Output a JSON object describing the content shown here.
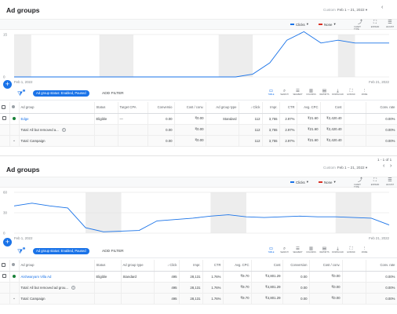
{
  "panel1": {
    "title": "Ad groups",
    "date_label": "Custom",
    "date_range": "Feb 1 – 21, 2022",
    "metric1": "Clicks",
    "metric2": "None",
    "metric1_color": "#1a73e8",
    "metric2_color": "#d93025",
    "chart_buttons": [
      "CHART TYPE",
      "EXPAND",
      "ADJUST"
    ],
    "chart_icons": [
      "trend-icon",
      "expand-icon",
      "adjust-icon"
    ],
    "chart_glyphs": [
      "⤴",
      "⛶",
      "☰"
    ],
    "chart_data": {
      "type": "line",
      "x_labels": [
        "Feb 1, 2022",
        "Feb 21, 2022"
      ],
      "y_ticks": [
        "15",
        "0"
      ],
      "ylim": [
        0,
        15
      ],
      "weekend_bands": [
        [
          0,
          1
        ],
        [
          5,
          7
        ],
        [
          12,
          14
        ],
        [
          19,
          20
        ]
      ],
      "series": [
        {
          "values": [
            0,
            0,
            0,
            0,
            0,
            0,
            0,
            0,
            0,
            0,
            0,
            0,
            0,
            0,
            1,
            5,
            13,
            16,
            12,
            13,
            12,
            12,
            12
          ]
        }
      ]
    },
    "filter_chip": "Ad group status: Enabled, Paused",
    "filter_badge": "1",
    "add_filter": "ADD FILTER",
    "tools": [
      {
        "label": "TABLE",
        "icon": "table-icon",
        "glyph": "▭",
        "active": true
      },
      {
        "label": "SEARCH",
        "icon": "search-icon",
        "glyph": "⌕",
        "active": false
      },
      {
        "label": "SEGMENT",
        "icon": "segment-icon",
        "glyph": "☰",
        "active": false
      },
      {
        "label": "COLUMNS",
        "icon": "columns-icon",
        "glyph": "▥",
        "active": false
      },
      {
        "label": "REPORTS",
        "icon": "reports-icon",
        "glyph": "▤",
        "active": false
      },
      {
        "label": "DOWNLOAD",
        "icon": "download-icon",
        "glyph": "⤓",
        "active": false
      },
      {
        "label": "EXPAND",
        "icon": "expand-icon",
        "glyph": "⛶",
        "active": false
      },
      {
        "label": "MORE",
        "icon": "more-icon",
        "glyph": "⋮",
        "active": false
      }
    ],
    "columns": [
      "Ad group",
      "Status",
      "Target CPA",
      "Conversio",
      "Cost / conv.",
      "Ad group type",
      "↓ Click",
      "Impr.",
      "CTR",
      "Avg. CPC",
      "Cost",
      "",
      "Conv. rate"
    ],
    "rows": [
      [
        "Edge",
        "Eligible",
        "—",
        "0.00",
        "₹0.00",
        "Standard",
        "112",
        "3,755",
        "2.97%",
        "₹21.60",
        "₹2,420.40",
        "",
        "0.00%"
      ]
    ],
    "totals": [
      [
        "Total: All but removed a...",
        "",
        "",
        "0.00",
        "₹0.00",
        "",
        "112",
        "3,755",
        "2.97%",
        "₹21.60",
        "₹2,420.40",
        "",
        "0.00%"
      ],
      [
        "Total: Campaign",
        "",
        "",
        "0.00",
        "₹0.00",
        "",
        "112",
        "3,755",
        "2.97%",
        "₹21.60",
        "₹2,420.40",
        "",
        "0.00%"
      ]
    ]
  },
  "panel2": {
    "title": "Ad groups",
    "pager": "1 - 1 of 1",
    "date_label": "Custom",
    "date_range": "Feb 1 – 21, 2022",
    "metric1": "Clicks",
    "metric2": "None",
    "chart_buttons": [
      "CHART TYPE",
      "EXPAND",
      "ADJUST"
    ],
    "chart_data": {
      "type": "line",
      "x_labels": [
        "Feb 1, 2022",
        "Feb 21, 2022"
      ],
      "y_ticks": [
        "60",
        "30",
        "0"
      ],
      "ylim": [
        0,
        60
      ],
      "weekend_bands": [
        [
          4,
          6
        ],
        [
          11,
          13
        ],
        [
          18,
          20
        ]
      ],
      "series": [
        {
          "values": [
            40,
            44,
            40,
            37,
            8,
            2,
            3,
            4,
            18,
            20,
            22,
            25,
            27,
            24,
            23,
            24,
            25,
            24,
            24,
            23,
            22,
            12
          ]
        }
      ]
    },
    "filter_chip": "Ad group status: Enabled, Paused",
    "filter_badge": "1",
    "add_filter": "ADD FILTER",
    "columns": [
      "Ad group",
      "Status",
      "Ad group type",
      "↓ Click",
      "Impr.",
      "CTR",
      "Avg. CPC",
      "Cost",
      "Conversion",
      "Cost / conv.",
      "",
      "Conv. rate"
    ],
    "rows": [
      [
        "Aishwaryam Villa Ad",
        "Eligible",
        "Standard",
        "495",
        "28,131",
        "1.76%",
        "₹9.70",
        "₹4,801.29",
        "0.00",
        "₹0.00",
        "",
        "0.00%"
      ]
    ],
    "totals": [
      [
        "Total: All but removed ad grou...",
        "",
        "",
        "495",
        "28,131",
        "1.76%",
        "₹9.70",
        "₹4,801.29",
        "0.00",
        "₹0.00",
        "",
        "0.00%"
      ],
      [
        "Total: Campaign",
        "",
        "",
        "495",
        "28,131",
        "1.76%",
        "₹9.70",
        "₹4,801.29",
        "0.00",
        "₹0.00",
        "",
        "0.00%"
      ]
    ]
  }
}
